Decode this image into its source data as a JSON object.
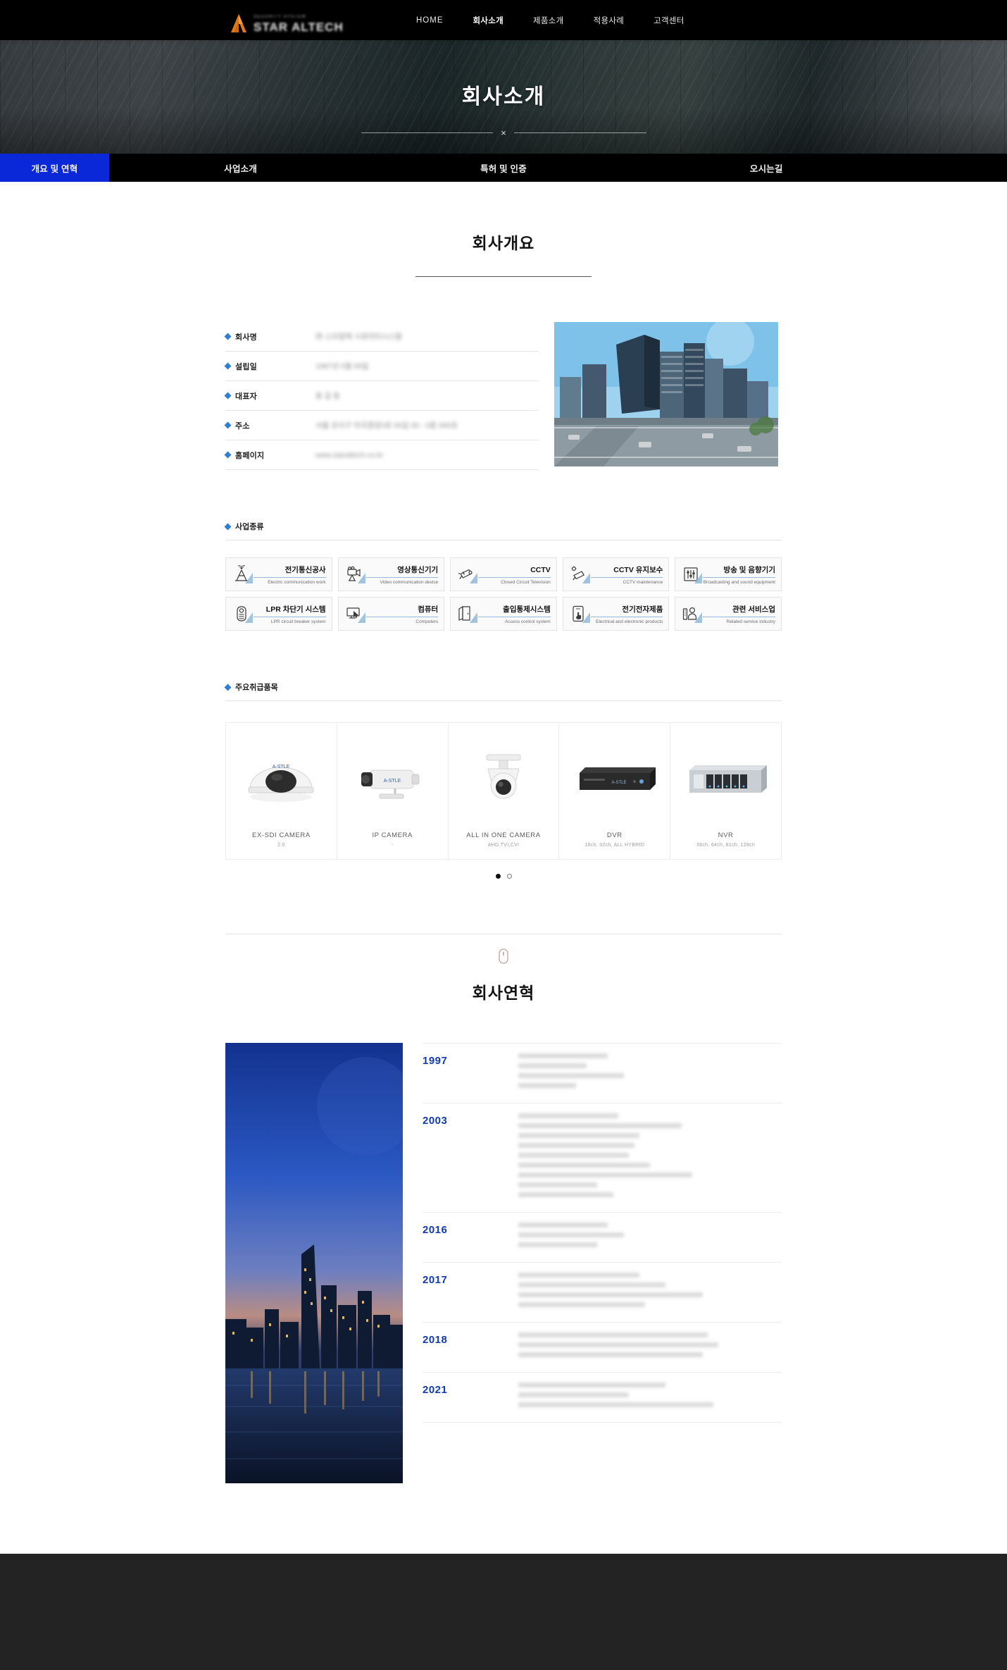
{
  "header": {
    "logo": {
      "small_text": "SECURITY SYSTEM",
      "main_text": "STAR ALTECH",
      "mark": "triangle-a-logo"
    },
    "nav": [
      {
        "label": "HOME",
        "active": false
      },
      {
        "label": "회사소개",
        "active": true
      },
      {
        "label": "제품소개",
        "active": false
      },
      {
        "label": "적용사례",
        "active": false
      },
      {
        "label": "고객센터",
        "active": false
      }
    ]
  },
  "hero": {
    "title": "회사소개",
    "divider_mark": "×"
  },
  "tabs": [
    {
      "label": "개요 및 연혁",
      "active": true
    },
    {
      "label": "사업소개",
      "active": false
    },
    {
      "label": "특허 및 인증",
      "active": false
    },
    {
      "label": "오시는길",
      "active": false
    }
  ],
  "overview": {
    "section_title": "회사개요",
    "info_rows": [
      {
        "label": "회사명",
        "value": "㈜ 스타알텍 시큐리티시스템"
      },
      {
        "label": "설립일",
        "value": "1997년 0월 00일"
      },
      {
        "label": "대표자",
        "value": "홍 길 동"
      },
      {
        "label": "주소",
        "value": "서울 강서구 마곡중앙0로 00길 00 - 0층 000호"
      },
      {
        "label": "홈페이지",
        "value": "www.staraltech.co.kr"
      }
    ],
    "photo_alt": "office-building-photo"
  },
  "business": {
    "heading": "사업종류",
    "items": [
      {
        "ko": "전기통신공사",
        "en": "Electric communication work",
        "icon": "antenna-tower-icon"
      },
      {
        "ko": "영상통신기기",
        "en": "Video communication device",
        "icon": "video-camera-icon"
      },
      {
        "ko": "CCTV",
        "en": "Closed Circuit Television",
        "icon": "cctv-camera-icon"
      },
      {
        "ko": "CCTV 유지보수",
        "en": "CCTV maintenance",
        "icon": "cctv-gear-icon"
      },
      {
        "ko": "방송 및 음향기기",
        "en": "Broadcasting and sound equipment",
        "icon": "sound-mixer-icon"
      },
      {
        "ko": "LPR 차단기 시스템",
        "en": "LPR circuit breaker system",
        "icon": "lpr-barrier-icon"
      },
      {
        "ko": "컴퓨터",
        "en": "Computers",
        "icon": "computer-monitor-icon"
      },
      {
        "ko": "출입통제시스템",
        "en": "Access control system",
        "icon": "door-access-icon"
      },
      {
        "ko": "전기전자제품",
        "en": "Electrical and electronic products",
        "icon": "touch-device-icon"
      },
      {
        "ko": "관련 서비스업",
        "en": "Related service industry",
        "icon": "service-person-icon"
      }
    ]
  },
  "products": {
    "heading": "주요취급품목",
    "items": [
      {
        "name": "EX-SDI CAMERA",
        "sub": "2.0",
        "icon": "dome-camera"
      },
      {
        "name": "IP CAMERA",
        "sub": "-",
        "icon": "bullet-camera"
      },
      {
        "name": "ALL IN ONE CAMERA",
        "sub": "AHD,TVI,CVI",
        "icon": "ptz-camera"
      },
      {
        "name": "DVR",
        "sub": "16ch, 32ch, ALL HYBRID",
        "icon": "dvr-unit"
      },
      {
        "name": "NVR",
        "sub": "36ch, 64ch, 81ch, 128ch",
        "icon": "nvr-rack"
      }
    ],
    "dots": [
      {
        "active": true
      },
      {
        "active": false
      }
    ]
  },
  "history": {
    "scroll_icon": "mouse-scroll-icon",
    "title": "회사연혁",
    "photo_alt": "city-night-skyline-photo",
    "rows": [
      {
        "year": "1997",
        "line_widths": [
          34,
          26,
          40,
          22
        ]
      },
      {
        "year": "2003",
        "line_widths": [
          38,
          62,
          46,
          44,
          42,
          50,
          66,
          30,
          36
        ]
      },
      {
        "year": "2016",
        "line_widths": [
          34,
          40,
          30
        ]
      },
      {
        "year": "2017",
        "line_widths": [
          46,
          56,
          70,
          48
        ]
      },
      {
        "year": "2018",
        "line_widths": [
          72,
          76,
          70
        ]
      },
      {
        "year": "2021",
        "line_widths": [
          56,
          42,
          74
        ]
      }
    ]
  }
}
